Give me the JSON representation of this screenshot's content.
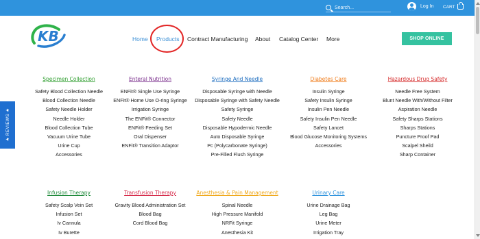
{
  "topbar": {
    "search_placeholder": "Search...",
    "login_label": "Log In",
    "cart_label": "CART"
  },
  "header": {
    "logo_text": "KB",
    "nav": [
      "Home",
      "Products",
      "Contract Manufacturing",
      "About",
      "Catalog Center",
      "More"
    ],
    "shop_button": "SHOP ONLINE"
  },
  "reviews_tab": {
    "label": "★ REVIEWS ★"
  },
  "colors": {
    "topbar": "#2f93dd",
    "accent": "#3a8fd6",
    "shop_button": "#35c2a0",
    "highlight_circle": "#e22424",
    "reviews_tab": "#1f6fd0"
  },
  "categories_row1": [
    {
      "title": "Specimen Collection",
      "color": "#2e9e2e",
      "items": [
        "Safety Blood Collection Needle",
        "Blood Collection Needle",
        "Safety Needle Holder",
        "Needle Holder",
        "Blood Collection Tube",
        "Vacuum Urine Tube",
        "Urine Cup",
        "Accessories"
      ]
    },
    {
      "title": "Enteral Nutrition",
      "color": "#7a2e8c",
      "items": [
        "ENFit® Single Use Syringe",
        "ENFit® Home Use O-ring Syringe",
        "Irrigation Syringe",
        "The ENFit® Connector",
        "ENFit® Feeding Set",
        "Oral Dispenser",
        "ENFit® Transition Adaptor"
      ]
    },
    {
      "title": "Syringe And Needle",
      "color": "#1f6fc0",
      "items": [
        "Disposable Syringe with Needle",
        "Disposable Syringe with Safety Needle",
        "Safety Syringe",
        "Safety Needle",
        "Disposable Hypodermic Needle",
        "Auto Disposable Syringe",
        "Pc (Polycarbonate Syringe)",
        "Pre-Filled Flush Syringe"
      ]
    },
    {
      "title": "Diabetes Care",
      "color": "#f07c1a",
      "items": [
        "Insulin Syringe",
        "Safety Insulin Syringe",
        "Insulin Pen Needle",
        "Safety Insulin Pen Needle",
        "Safety Lancet",
        "Blood Glucose Monitoring Systems",
        "Accessories"
      ]
    },
    {
      "title": "Hazardous Drug Safety",
      "color": "#d62b2b",
      "items": [
        "Needle Free System",
        "Blunt Needle With/Without Filter",
        "Aspiration Needle",
        "Safety Sharps Stations",
        "Sharps Stations",
        "Puncture Proof Pad",
        "Scalpel Sheild",
        "Sharp Container"
      ]
    }
  ],
  "categories_row2": [
    {
      "title": "Infusion Therapy",
      "color": "#1e8a3a",
      "items": [
        "Safety Scalp Vein Set",
        "Infusion Set",
        "Iv Cannula",
        "Iv Burette"
      ]
    },
    {
      "title": "Transfusion Therapy",
      "color": "#d62b4a",
      "items": [
        "Gravity Blood Administration Set",
        "Blood Bag",
        "Cord Blood Bag"
      ]
    },
    {
      "title": "Anesthesia & Pain Management",
      "color": "#f0a81a",
      "items": [
        "Spinal Needle",
        "High Pressure Manifold",
        "NRFit Syringe",
        "Anesthesia Kit"
      ]
    },
    {
      "title": "Urinary Care",
      "color": "#2f93dd",
      "items": [
        "Urine Drainage Bag",
        "Leg Bag",
        "Urine Meter",
        "Irrigation Tray"
      ]
    }
  ]
}
